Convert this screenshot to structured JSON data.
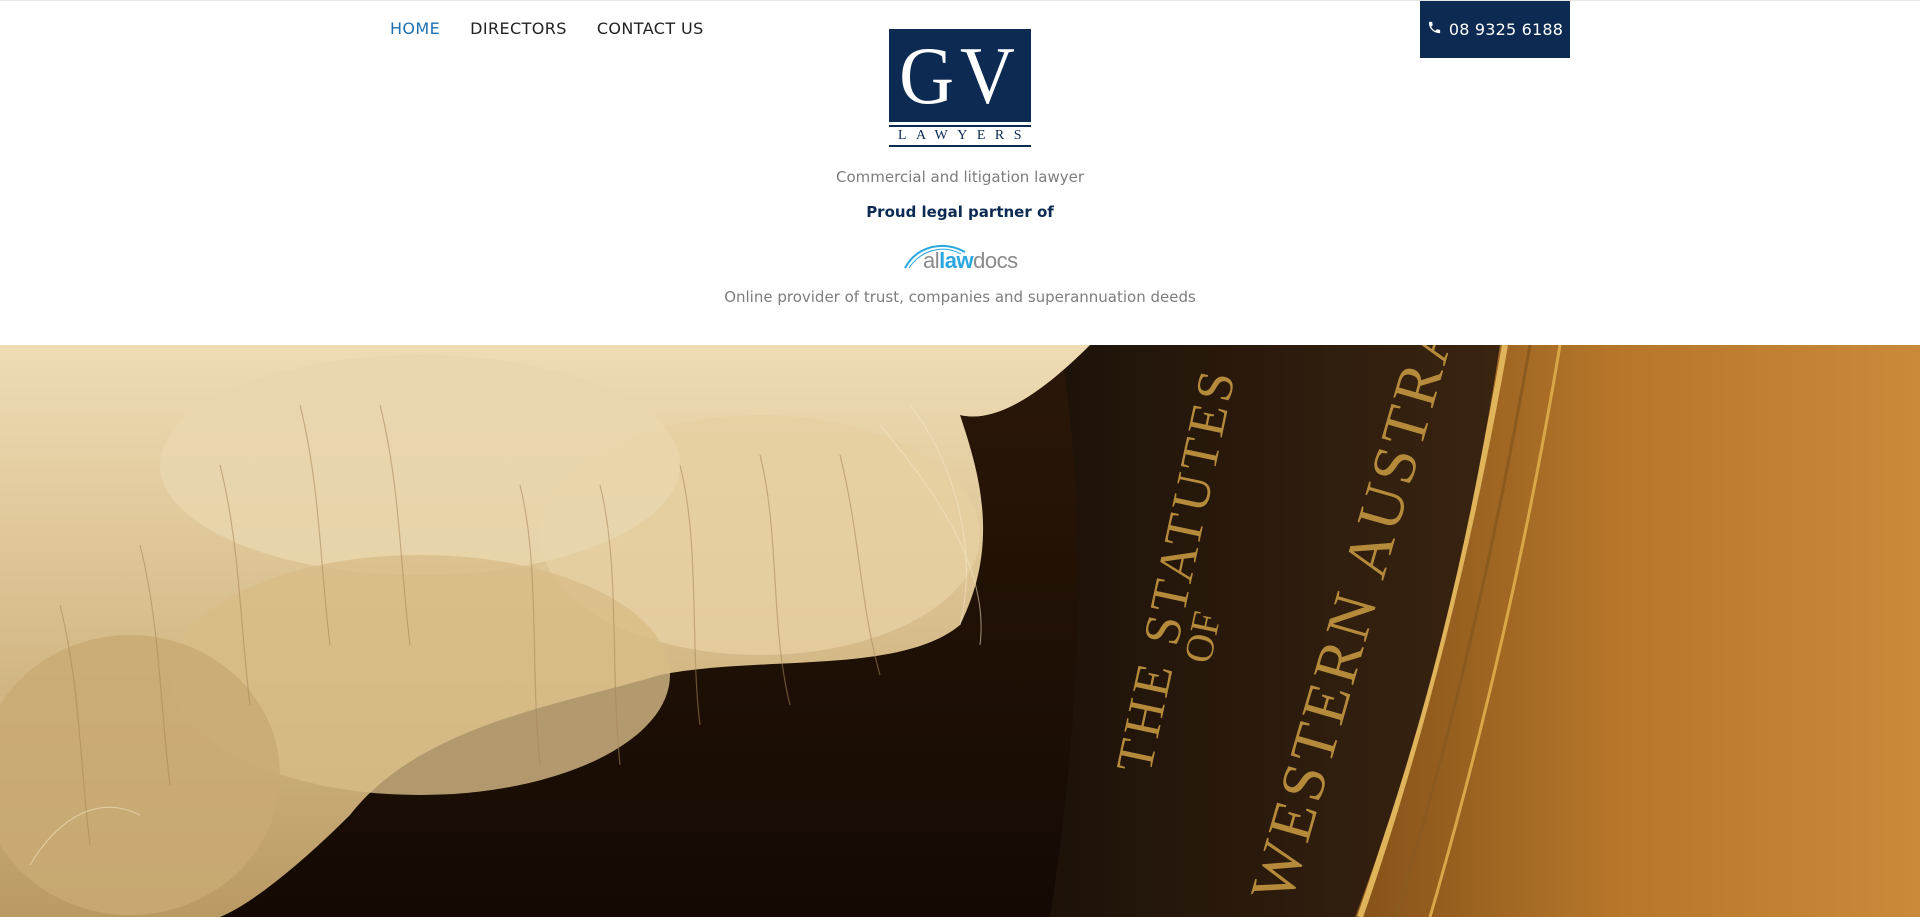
{
  "nav": {
    "items": [
      {
        "label": "HOME",
        "active": true
      },
      {
        "label": "DIRECTORS",
        "active": false
      },
      {
        "label": "CONTACT US",
        "active": false
      }
    ]
  },
  "phone": {
    "number": "08 9325 6188",
    "icon": "phone-icon"
  },
  "logo": {
    "initials": "GV",
    "word": "LAWYERS"
  },
  "tagline": "Commercial and litigation lawyer",
  "partner_text": "Proud legal partner of",
  "partner_logo": {
    "part1": "al",
    "part2": "law",
    "part3": "docs"
  },
  "partner_description": "Online provider of trust, companies and superannuation deeds",
  "hero": {
    "book_line1": "THE STATUTES",
    "book_line2": "OF",
    "book_line3": "WESTERN AUSTRALIA"
  },
  "colors": {
    "navy": "#0c2a52",
    "accent": "#1f6fb2",
    "alllaw_blue": "#2aa7df"
  }
}
